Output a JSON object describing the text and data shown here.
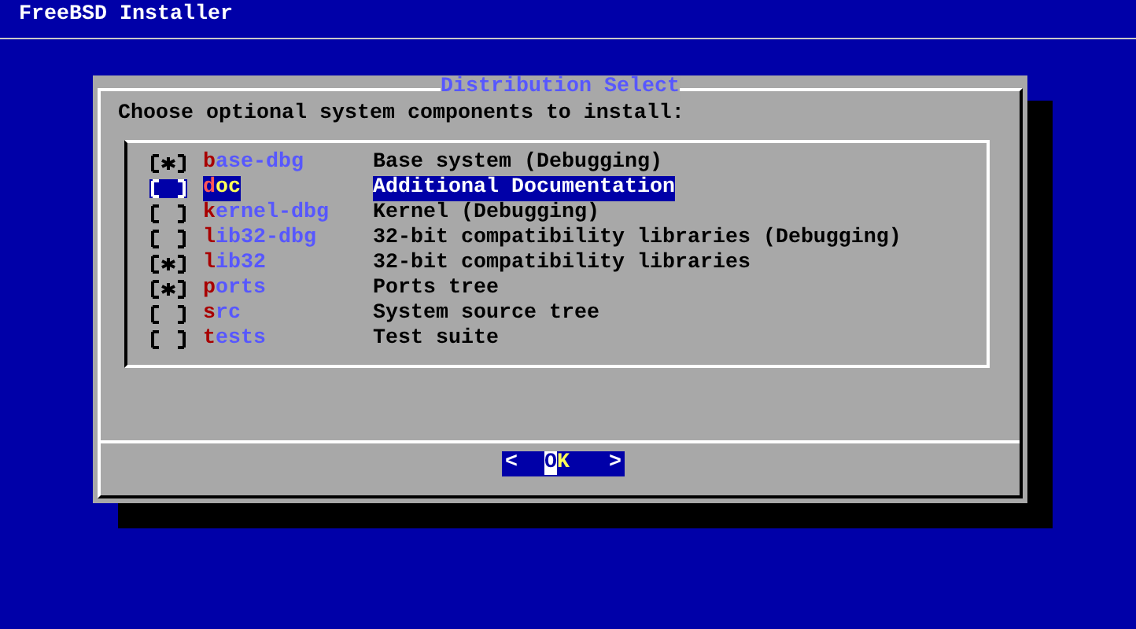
{
  "app_title": "FreeBSD Installer",
  "dialog": {
    "title": "Distribution Select",
    "prompt": "Choose optional system components to install:",
    "items": [
      {
        "name": "base-dbg",
        "description": "Base system (Debugging)",
        "checked": true,
        "selected": false
      },
      {
        "name": "doc",
        "description": "Additional Documentation",
        "checked": false,
        "selected": true
      },
      {
        "name": "kernel-dbg",
        "description": "Kernel (Debugging)",
        "checked": false,
        "selected": false
      },
      {
        "name": "lib32-dbg",
        "description": "32-bit compatibility libraries (Debugging)",
        "checked": false,
        "selected": false
      },
      {
        "name": "lib32",
        "description": "32-bit compatibility libraries",
        "checked": true,
        "selected": false
      },
      {
        "name": "ports",
        "description": "Ports tree",
        "checked": true,
        "selected": false
      },
      {
        "name": "src",
        "description": "System source tree",
        "checked": false,
        "selected": false
      },
      {
        "name": "tests",
        "description": "Test suite",
        "checked": false,
        "selected": false
      }
    ],
    "button": {
      "open": "<",
      "label": "OK",
      "close": ">"
    }
  }
}
